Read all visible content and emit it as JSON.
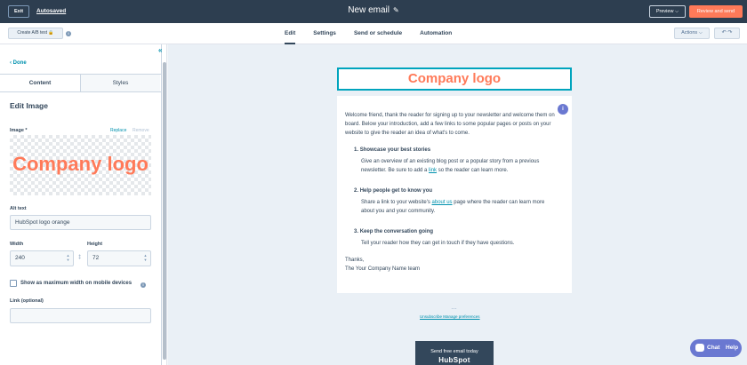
{
  "topbar": {
    "exit_label": "Exit",
    "autosaved_label": "Autosaved",
    "title": "New email",
    "preview_label": "Preview ⌵",
    "review_label": "Review and send"
  },
  "subbar": {
    "ab_label": "Create A/B test 🔒",
    "tabs": [
      "Edit",
      "Settings",
      "Send or schedule",
      "Automation"
    ],
    "actions_label": "Actions ⌵",
    "undo_redo": "↶ ↷"
  },
  "sidebar": {
    "collapse_glyph": "«",
    "done_label": "‹  Done",
    "tabs": [
      "Content",
      "Styles"
    ],
    "heading": "Edit Image",
    "image_label": "Image *",
    "replace_label": "Replace",
    "remove_label": "Remove",
    "preview_logo_text": "Company logo",
    "alt_label": "Alt text",
    "alt_value": "HubSpot logo orange",
    "width_label": "Width",
    "width_value": "240",
    "height_label": "Height",
    "height_value": "72",
    "lock_glyph": "‡",
    "max_width_label": "Show as maximum width on mobile devices",
    "link_label": "Link (optional)",
    "link_value": ""
  },
  "email": {
    "logo_text": "Company logo",
    "intro": "Welcome friend, thank the reader for signing up to your newsletter and welcome them on board. Below your introduction, add a few links to some popular pages or posts on your website to give the reader an idea of what's to come.",
    "items": [
      {
        "number": "1.",
        "title": "Showcase your best stories",
        "line1": "Give an overview of an existing blog post or a popular story from a previous",
        "line2a": "newsletter. Be sure to add a ",
        "link": "link",
        "line2b": " so the reader can learn more."
      },
      {
        "number": "2.",
        "title": "Help people get to know you",
        "line1a": "Share a link to your website's ",
        "link": "about us",
        "line1b": " page where the reader can learn more",
        "line2": "about you and your community."
      },
      {
        "number": "3.",
        "title": "Keep the conversation going",
        "line1": "Tell your reader how they can get in touch if they have questions."
      }
    ],
    "signoff": "Thanks,",
    "team": "The Your Company Name team",
    "footer_dots": "…",
    "footer_links": "Unsubscribe  Manage preferences",
    "badge_line1": "Send free email today",
    "badge_line2": "HubSpot",
    "info_glyph": "i"
  },
  "chat": {
    "label": "Chat",
    "help": "Help"
  },
  "colors": {
    "accent": "#ff7a59",
    "teal": "#0091ae",
    "navy": "#2d3e50",
    "purple": "#6a78d1"
  }
}
